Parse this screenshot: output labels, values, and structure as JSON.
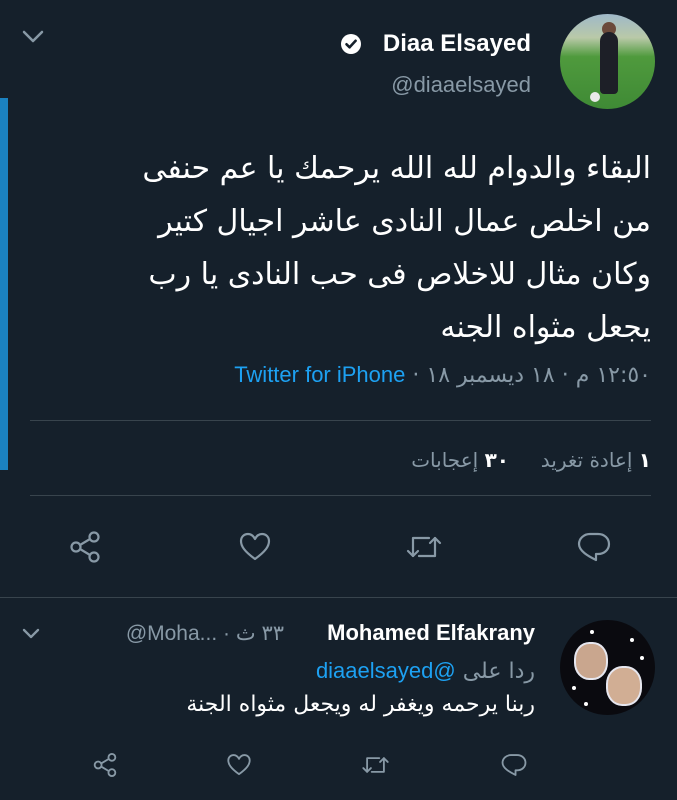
{
  "tweet": {
    "author_name": "Diaa Elsayed",
    "author_handle": "@diaaelsayed",
    "text": "البقاء والدوام لله الله يرحمك يا عم حنفى\nمن اخلص عمال النادى عاشر اجيال كتير\nوكان مثال للاخلاص فى حب النادى يا رب\nيجعل مثواه الجنه",
    "time": "١٢:٥٠ م",
    "date": "١٨ ديسمبر ١٨",
    "separator": "·",
    "source": "Twitter for iPhone",
    "retweets_count": "١",
    "retweets_label": "إعادة تغريد",
    "likes_count": "٣٠",
    "likes_label": "إعجابات"
  },
  "reply": {
    "author_name": "Mohamed Elfakrany",
    "handle_time": "@Moha... · ٣٣ ث",
    "replying_label": "ردا على",
    "replying_to": "@diaaelsayed",
    "text": "ربنا يرحمه ويغفر له ويجعل مثواه الجنة"
  },
  "icons": [
    "chevron-down-icon",
    "verified-badge-icon",
    "share-icon",
    "like-icon",
    "retweet-icon",
    "reply-icon"
  ],
  "colors": {
    "background": "#15202b",
    "accent": "#1da1f2",
    "secondary_text": "#8899a6",
    "divider": "#38444d"
  }
}
